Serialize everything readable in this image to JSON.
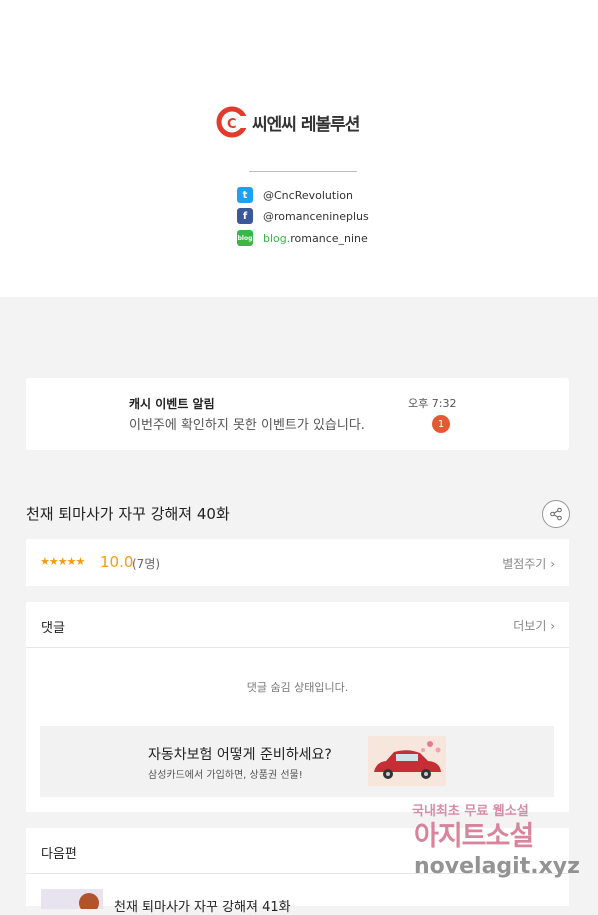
{
  "brand": {
    "name": "씨엔씨 레볼루션",
    "color": "#e23b2e"
  },
  "social": [
    {
      "icon": "twitter-icon",
      "text": "@CncRevolution"
    },
    {
      "icon": "facebook-icon",
      "text": "@romancenineplus"
    },
    {
      "icon": "blog-icon",
      "prefix": "blog.",
      "text": "romance_nine"
    }
  ],
  "notice": {
    "title": "캐시 이벤트 알림",
    "message": "이번주에 확인하지 못한 이벤트가 있습니다.",
    "time": "오후 7:32",
    "badge": "1"
  },
  "episode": {
    "title": "천재 퇴마사가 자꾸 강해져 40화"
  },
  "rating": {
    "stars": "★★★★★",
    "score": "10.0",
    "count": "(7명)",
    "action": "별점주기"
  },
  "comments": {
    "title": "댓글",
    "more": "더보기",
    "hidden_text": "댓글 숨김 상태입니다."
  },
  "ad": {
    "title": "자동차보험 어떻게 준비하세요?",
    "subtitle": "삼성카드에서 가입하면, 상품권 선물!"
  },
  "next": {
    "title": "다음편",
    "episode_title": "천재 퇴마사가 자꾸 강해져 41화"
  },
  "watermark": {
    "line1": "국내최초 무료 웹소설",
    "line2": "아지트소설",
    "line3": "novelagit.xyz"
  }
}
